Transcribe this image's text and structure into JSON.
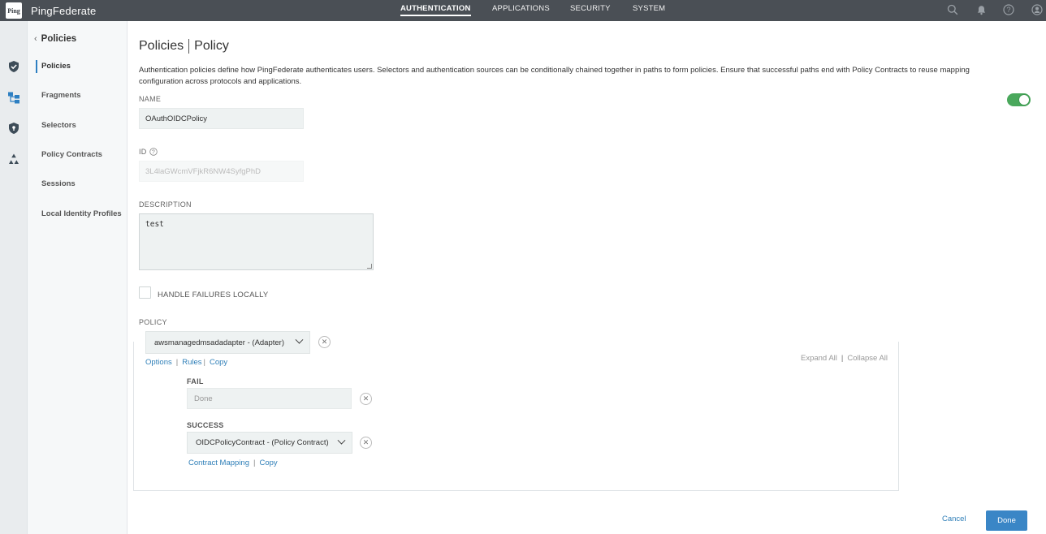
{
  "brand": {
    "logo_text": "Ping",
    "name": "PingFederate"
  },
  "nav": {
    "items": [
      {
        "label": "AUTHENTICATION",
        "active": true
      },
      {
        "label": "APPLICATIONS",
        "active": false
      },
      {
        "label": "SECURITY",
        "active": false
      },
      {
        "label": "SYSTEM",
        "active": false
      }
    ]
  },
  "top_icons": [
    "search-icon",
    "bell-icon",
    "help-icon",
    "user-icon"
  ],
  "rail_icons": [
    "shield-check-icon",
    "policy-tree-icon",
    "shield-lock-icon",
    "recycle-icon"
  ],
  "subnav": {
    "header": "Policies",
    "items": [
      {
        "label": "Policies",
        "active": true
      },
      {
        "label": "Fragments",
        "active": false
      },
      {
        "label": "Selectors",
        "active": false
      },
      {
        "label": "Policy Contracts",
        "active": false
      },
      {
        "label": "Sessions",
        "active": false
      },
      {
        "label": "Local Identity Profiles",
        "active": false
      }
    ]
  },
  "page": {
    "title_left": "Policies",
    "title_right": "Policy",
    "description": "Authentication policies define how PingFederate authenticates users. Selectors and authentication sources can be conditionally chained together in paths to form policies. Ensure that successful paths end with Policy Contracts to reuse mapping configuration across protocols and applications."
  },
  "form": {
    "name_label": "NAME",
    "name_value": "OAuthOIDCPolicy",
    "enabled": true,
    "id_label": "ID",
    "id_value": "3L4laGWcmVFjkR6NW4SyfgPhD",
    "description_label": "DESCRIPTION",
    "description_value": "test",
    "handle_failures_label": "HANDLE FAILURES LOCALLY",
    "handle_failures_checked": false,
    "policy_label": "POLICY"
  },
  "policy": {
    "adapter_value": "awsmanagedmsadadapter - (Adapter)",
    "adapter_links": [
      "Options",
      "Rules",
      "Copy"
    ],
    "expand_all": "Expand All",
    "collapse_all": "Collapse All",
    "fail_label": "FAIL",
    "fail_placeholder": "Done",
    "success_label": "SUCCESS",
    "success_value": "OIDCPolicyContract - (Policy Contract)",
    "success_links": [
      "Contract Mapping",
      "Copy"
    ]
  },
  "footer": {
    "cancel": "Cancel",
    "done": "Done"
  },
  "colors": {
    "topbar": "#4a4f55",
    "accent": "#3a86c6",
    "toggle_on": "#4aa85c",
    "link": "#2f7fb8"
  }
}
